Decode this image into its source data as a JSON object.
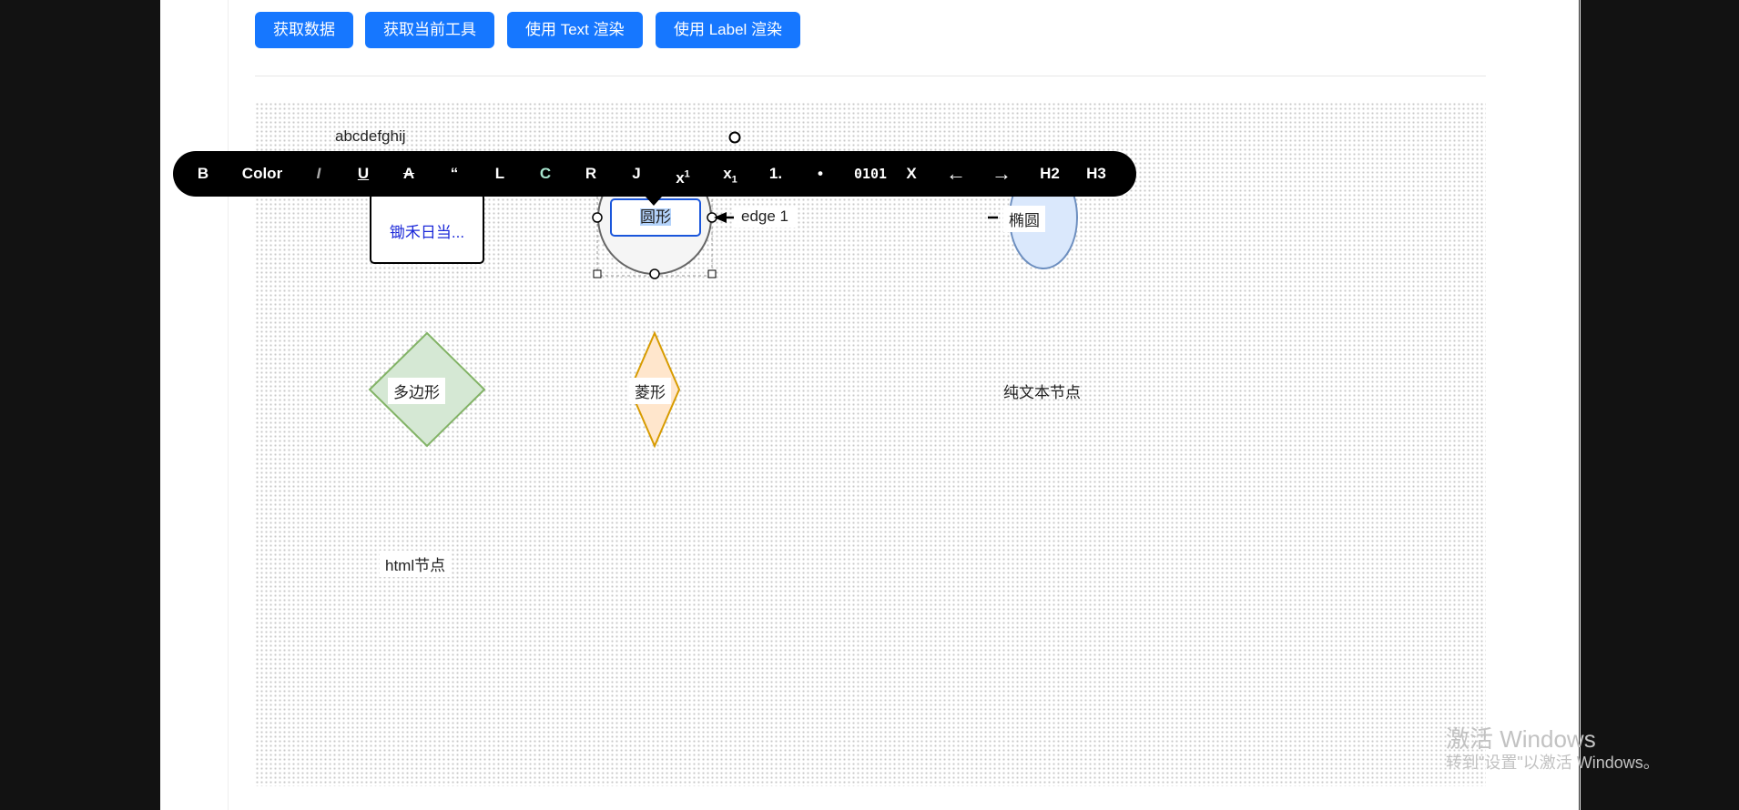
{
  "toolbar_buttons": [
    {
      "label": "获取数据"
    },
    {
      "label": "获取当前工具"
    },
    {
      "label": "使用 Text 渲染"
    },
    {
      "label": "使用 Label 渲染"
    }
  ],
  "canvas": {
    "text_top": "abcdefghij",
    "rect_node": "锄禾日当...",
    "circle_node": "圆形",
    "edge_label": "edge 1",
    "ellipse_node": "椭圆",
    "polygon_node": "多边形",
    "rhombus_node": "菱形",
    "text_node": "纯文本节点",
    "html_node": "html节点"
  },
  "text_toolbar": {
    "bold": "B",
    "color": "Color",
    "italic": "I",
    "underline": "U",
    "strike": "A",
    "quote": "“",
    "align_left": "L",
    "align_center": "C",
    "align_right": "R",
    "justify": "J",
    "superscript": "x1",
    "subscript": "x1",
    "ordered_list": "1.",
    "bullet_list": "•",
    "code": "0101",
    "clear": "X",
    "undo": "←",
    "redo": "→",
    "h2": "H2",
    "h3": "H3"
  },
  "colors": {
    "primary_button": "#1677ff",
    "circle_fill": "#f5f5f5",
    "ellipse_fill": "#dae8fc",
    "ellipse_stroke": "#6c8ebf",
    "polygon_fill": "#d5e8d4",
    "polygon_stroke": "#82b366",
    "rhombus_fill": "#ffe6cc",
    "rhombus_stroke": "#d79b00",
    "center_align_color": "#a8e6cf"
  },
  "watermark": {
    "line1": "激活 Windows",
    "line2": "转到\"设置\"以激活 Windows。"
  }
}
